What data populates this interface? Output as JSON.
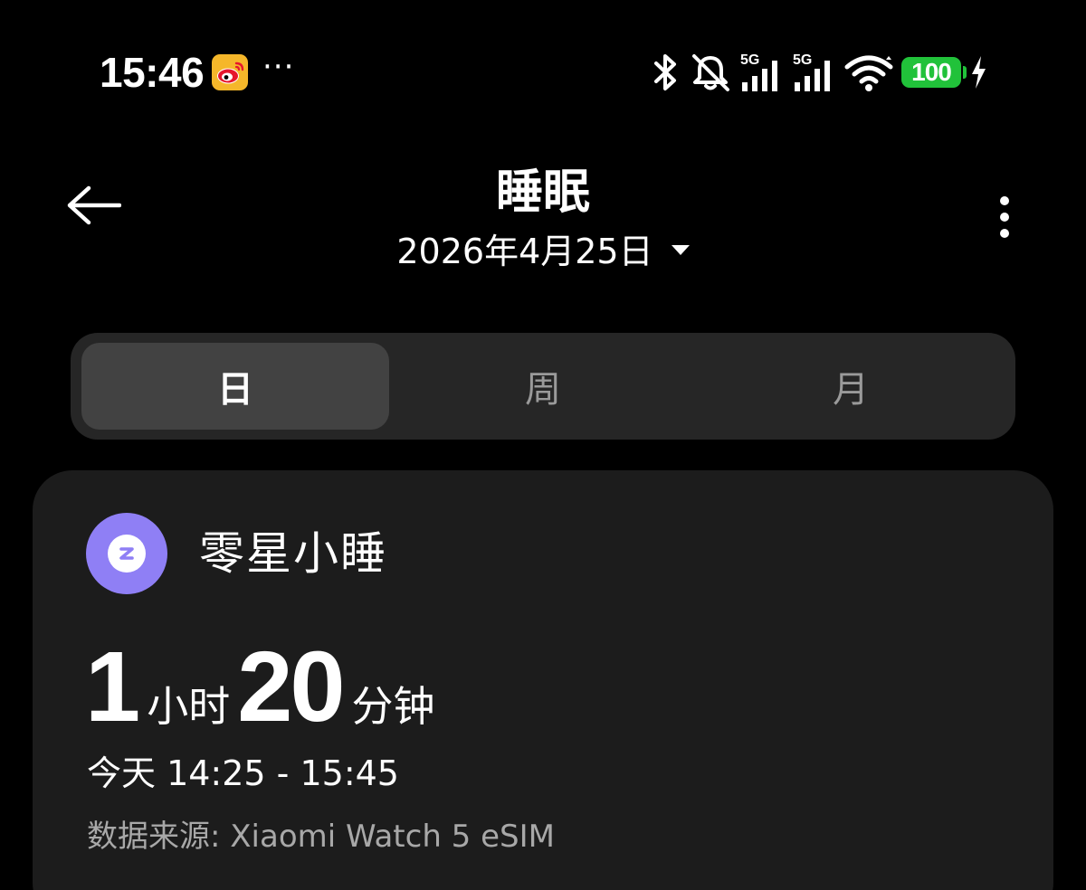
{
  "status_bar": {
    "time": "15:46",
    "more": "···",
    "network_1": "5G",
    "network_2": "5G",
    "battery": "100",
    "icons": [
      "weibo-icon",
      "bluetooth-icon",
      "mute-bell-icon",
      "signal-icon",
      "signal-icon",
      "wifi-icon",
      "battery-icon",
      "charging-icon"
    ]
  },
  "header": {
    "title": "睡眠",
    "date": "2026年4月25日"
  },
  "tabs": [
    {
      "label": "日",
      "active": true
    },
    {
      "label": "周",
      "active": false
    },
    {
      "label": "月",
      "active": false
    }
  ],
  "card": {
    "icon": "nap-z-icon",
    "title": "零星小睡",
    "hours": "1",
    "hours_unit": "小时",
    "minutes": "20",
    "minutes_unit": "分钟",
    "time_range": "今天 14:25 - 15:45",
    "source": "数据来源: Xiaomi Watch 5 eSIM"
  },
  "colors": {
    "background": "#000000",
    "card": "#1c1c1c",
    "segmented_bg": "#262626",
    "segmented_active": "#424242",
    "nap_icon": "#8f7ff5",
    "battery": "#21c23a"
  }
}
